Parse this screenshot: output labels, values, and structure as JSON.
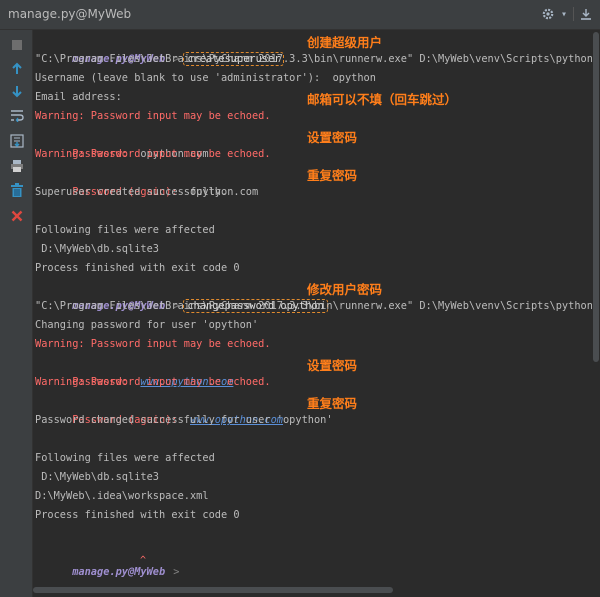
{
  "window": {
    "title": "manage.py@MyWeb"
  },
  "header": {
    "icons": [
      "gear-icon",
      "chevron-down-icon",
      "download-icon"
    ]
  },
  "toolbar": {
    "items": [
      "stop-icon",
      "scroll-up-icon",
      "scroll-down-icon",
      "soft-wrap-icon",
      "scroll-to-end-icon",
      "print-icon",
      "trash-icon",
      "close-icon"
    ]
  },
  "console": {
    "prompt": "manage.py@MyWeb",
    "prompt_arrow": ">",
    "lines": {
      "l1_cmd": "createsuperuser",
      "l2": "\"C:\\Program Files\\JetBrains\\PyCharm 2017.3.3\\bin\\runnerw.exe\" D:\\MyWeb\\venv\\Scripts\\python.exe",
      "l3": "Username (leave blank to use 'administrator'):  opython",
      "l4": "Email address:",
      "l5": "Warning: Password input may be echoed.",
      "l6_label": "Password:",
      "l6_value": "opython.com",
      "l7": "Warning: Password input may be echoed.",
      "l8_label": "Password (again):",
      "l8_value": "opython.com",
      "l9": "Superuser created successfully.",
      "l11": "Following files were affected",
      "l12": " D:\\MyWeb\\db.sqlite3",
      "l13": "Process finished with exit code 0",
      "l14_cmd": "changepassword opython",
      "l15": "\"C:\\Program Files\\JetBrains\\PyCharm 2017.3.3\\bin\\runnerw.exe\" D:\\MyWeb\\venv\\Scripts\\python.exe",
      "l16": "Changing password for user 'opython'",
      "l17": "Warning: Password input may be echoed.",
      "l18_label": "Password:",
      "l18_value": "www.opython.com",
      "l19": "Warning: Password input may be echoed.",
      "l20_label": "Password (again):",
      "l20_value": "www.opython.com",
      "l21": "Password changed successfully for user 'opython'",
      "l23": "Following files were affected",
      "l24": " D:\\MyWeb\\db.sqlite3",
      "l25": "D:\\MyWeb\\.idea\\workspace.xml",
      "l26": "Process finished with exit code 0",
      "caret": "^"
    }
  },
  "annotations": {
    "create_superuser": "创建超级用户",
    "email_optional": "邮箱可以不填（回车跳过）",
    "set_password_1": "设置密码",
    "repeat_password_1": "重复密码",
    "change_password": "修改用户密码",
    "set_password_2": "设置密码",
    "repeat_password_2": "重复密码"
  },
  "colors": {
    "accent": "#ff7e1a",
    "warning": "#ff6b68",
    "link": "#5a8fd8",
    "prompt": "#9f8fd0"
  }
}
